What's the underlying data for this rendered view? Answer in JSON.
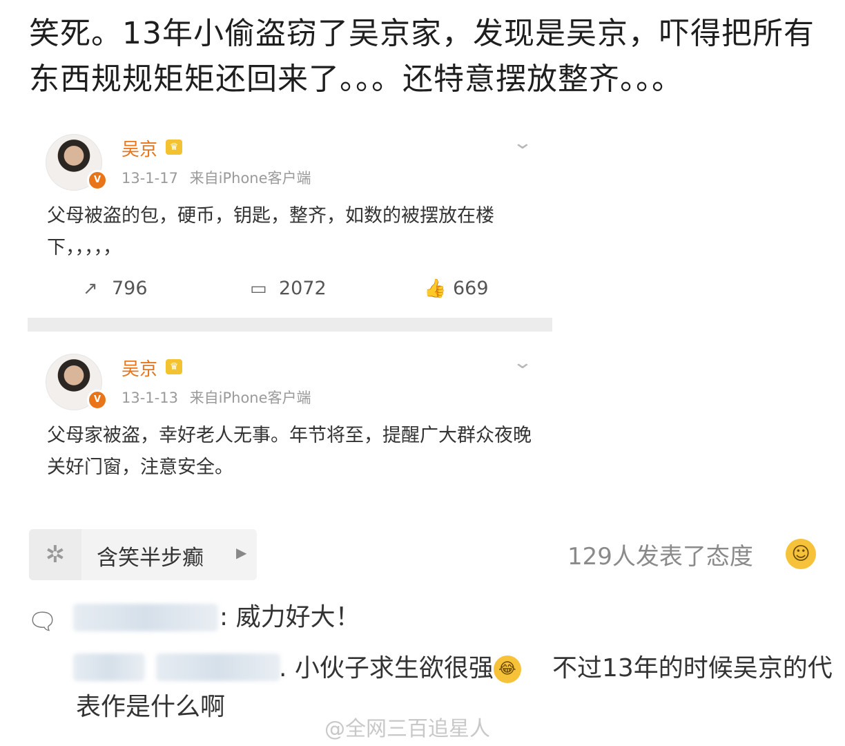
{
  "caption": "笑死。13年小偷盗窃了吴京家，发现是吴京，吓得把所有东西规规矩矩还回来了。。。还特意摆放整齐。。。",
  "posts": [
    {
      "username": "吴京",
      "time": "13-1-17",
      "source": "来自iPhone客户端",
      "text": "父母被盗的包，硬币，钥匙，整齐，如数的被摆放在楼下，，，，，",
      "reposts": "796",
      "comments": "2072",
      "likes": "669"
    },
    {
      "username": "吴京",
      "time": "13-1-13",
      "source": "来自iPhone客户端",
      "text": "父母家被盗，幸好老人无事。年节将至，提醒广大群众夜晚关好门窗，注意安全。"
    }
  ],
  "topic": {
    "label": "含笑半步癫"
  },
  "attitude": "129人发表了态度",
  "replies": [
    {
      "text": ": 威力好大！"
    },
    {
      "text": ". 小伙子求生欲很强",
      "emoji": "😂",
      "text2": "不过13年的时候吴京的代表作是什么啊"
    }
  ],
  "watermark": "@全网三百追星人",
  "icons": {
    "repost": "repost-icon",
    "comment": "comment-icon",
    "like": "thumbs-up-icon",
    "topic": "topic-icon",
    "smiley": "smiley-icon"
  },
  "colors": {
    "accent": "#e8751a",
    "muted": "#9a9a9a"
  }
}
